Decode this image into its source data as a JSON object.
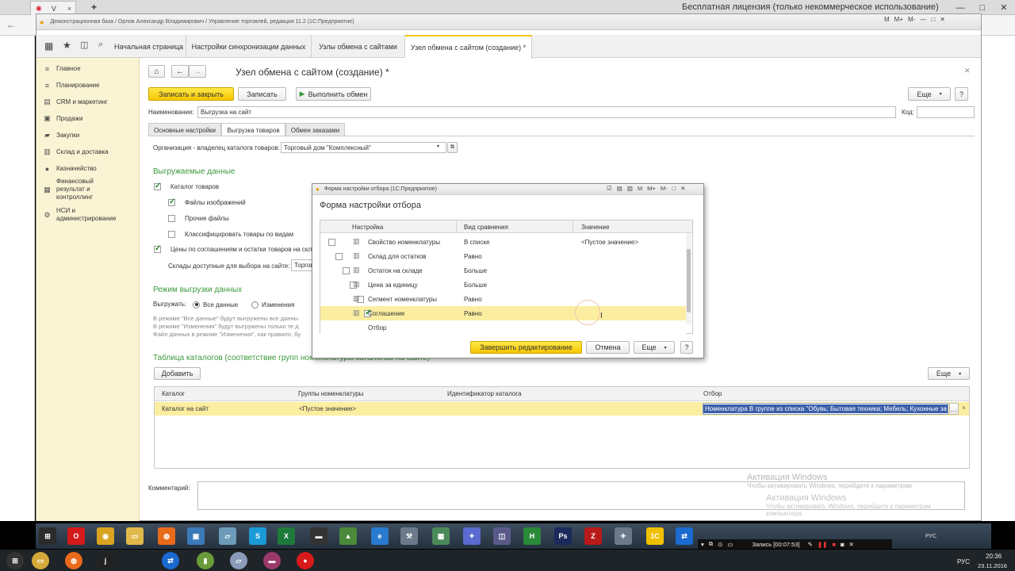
{
  "browser": {
    "license_text": "Бесплатная лицензия (только некоммерческое использование)"
  },
  "app": {
    "title": "Демонстрационная база / Орлов Александр Владимирович / Управление торговлей, редакция 11.2 (1С:Предприятие)",
    "title_buttons": [
      "M",
      "M+",
      "M-"
    ]
  },
  "tabs": [
    "Начальная страница",
    "Настройки синхронизации данных",
    "Узлы обмена с сайтами",
    "Узел обмена с сайтом (создание) *"
  ],
  "sidebar": {
    "items": [
      {
        "label": "Главное",
        "icon": "lines-icon"
      },
      {
        "label": "Планирование",
        "icon": "lines-icon"
      },
      {
        "label": "CRM и маркетинг",
        "icon": "chart-icon"
      },
      {
        "label": "Продажи",
        "icon": "cart-icon"
      },
      {
        "label": "Закупки",
        "icon": "truck-icon"
      },
      {
        "label": "Склад и доставка",
        "icon": "box-icon"
      },
      {
        "label": "Казначейство",
        "icon": "coin-icon"
      },
      {
        "label": "Финансовый результат и контроллинг",
        "icon": "graph-icon"
      },
      {
        "label": "НСИ и администрирование",
        "icon": "gear-icon"
      }
    ]
  },
  "form": {
    "title": "Узел обмена с сайтом (создание) *",
    "save_close": "Записать и закрыть",
    "save": "Записать",
    "run_exchange": "Выполнить обмен",
    "more": "Еще",
    "help": "?",
    "name_label": "Наименование:",
    "name_value": "Выгрузка на сайт",
    "code_label": "Код:",
    "subtabs": [
      "Основные настройки",
      "Выгрузка товаров",
      "Обмен заказами"
    ],
    "org_label": "Организация - владелец каталога товаров:",
    "org_value": "Торговый дом \"Комплексный\"",
    "section_data": "Выгружаемые данные",
    "cb_catalog": "Каталог товаров",
    "cb_images": "Файлы изображений",
    "cb_other": "Прочие файлы",
    "cb_classify": "Классифицировать товары по видам",
    "cb_prices": "Цены по соглашениям и остатки товаров на скл",
    "warehouses_label": "Склады доступные для выбора на сайте:",
    "warehouses_value": "Торгов",
    "section_mode": "Режим выгрузки данных",
    "unload_label": "Выгружать:",
    "radio_all": "Все данные",
    "radio_changes": "Изменения",
    "note1": "В режиме \"Все данные\" будут выгружены все данны",
    "note2": "В режиме \"Изменения\" будут выгружены только те д",
    "note3": "Файл данных в режиме \"Изменения\", как правило, бу",
    "section_table": "Таблица каталогов (соответствие групп номенклатуры каталогам на сайте)",
    "add": "Добавить",
    "comment_label": "Комментарий:",
    "table": {
      "headers": [
        "Каталог",
        "Группы номенклатуры",
        "Идентификатор каталога",
        "Отбор"
      ],
      "rows": [
        [
          "Каталог на сайт",
          "<Пустое значение>",
          "",
          "Номенклатура В группе из списка \"Обувь; Бытовая техника; Мебель; Кухонные за"
        ]
      ]
    }
  },
  "dialog": {
    "window_title": "Форма настройки отбора (1С:Предприятие)",
    "heading": "Форма настройки отбора",
    "headers": [
      "Настройка",
      "Вид сравнения",
      "Значение"
    ],
    "rows": [
      {
        "name": "Свойство номенклатуры",
        "cmp": "В списке",
        "val": "<Пустое значение>",
        "checked": false
      },
      {
        "name": "Склад для остатков",
        "cmp": "Равно",
        "val": "",
        "checked": false
      },
      {
        "name": "Остаток на складе",
        "cmp": "Больше",
        "val": "",
        "checked": false
      },
      {
        "name": "Цена за единицу",
        "cmp": "Больше",
        "val": "",
        "checked": false
      },
      {
        "name": "Сегмент номенклатуры",
        "cmp": "Равно",
        "val": "",
        "checked": false
      },
      {
        "name": "Соглашение",
        "cmp": "Равно",
        "val": "",
        "checked": true
      },
      {
        "name": "Отбор",
        "cmp": "",
        "val": "",
        "checked": false
      }
    ],
    "finish": "Завершить редактирование",
    "cancel": "Отмена",
    "more": "Еще",
    "help": "?"
  },
  "watermark": {
    "line1": "Активация Windows",
    "line2": "Чтобы активировать Windows, перейдите к параметрам",
    "line3": "компьютера."
  },
  "recording": {
    "label": "Запись [00:07:53]"
  },
  "taskbar": {
    "lang": "РУС",
    "time": "20:36",
    "date": "23.11.2016"
  },
  "colors": {
    "accent_yellow": "#f6c600",
    "selected_row": "#fbeea0",
    "section_green": "#3c9a3c",
    "taskbar": "#1a2a3a"
  }
}
